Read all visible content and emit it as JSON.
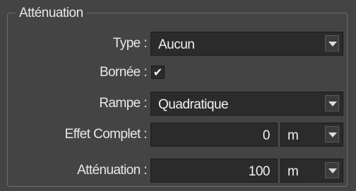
{
  "group": {
    "title": "Atténuation"
  },
  "rows": {
    "type": {
      "label": "Type :",
      "value": "Aucun"
    },
    "bornee": {
      "label": "Bornée :",
      "checked": true,
      "check_glyph": "✔"
    },
    "rampe": {
      "label": "Rampe :",
      "value": "Quadratique"
    },
    "effet_complet": {
      "label": "Effet Complet :",
      "value": "0",
      "unit": "m"
    },
    "attenuation": {
      "label": "Atténuation :",
      "value": "100",
      "unit": "m"
    }
  },
  "icons": {
    "dropdown": "chevron-down-icon",
    "checkmark": "checkmark-icon"
  },
  "colors": {
    "panel_bg": "#444444",
    "field_bg": "#2b2b2b",
    "text": "#e6e6e6",
    "border": "#6c6c6c"
  }
}
